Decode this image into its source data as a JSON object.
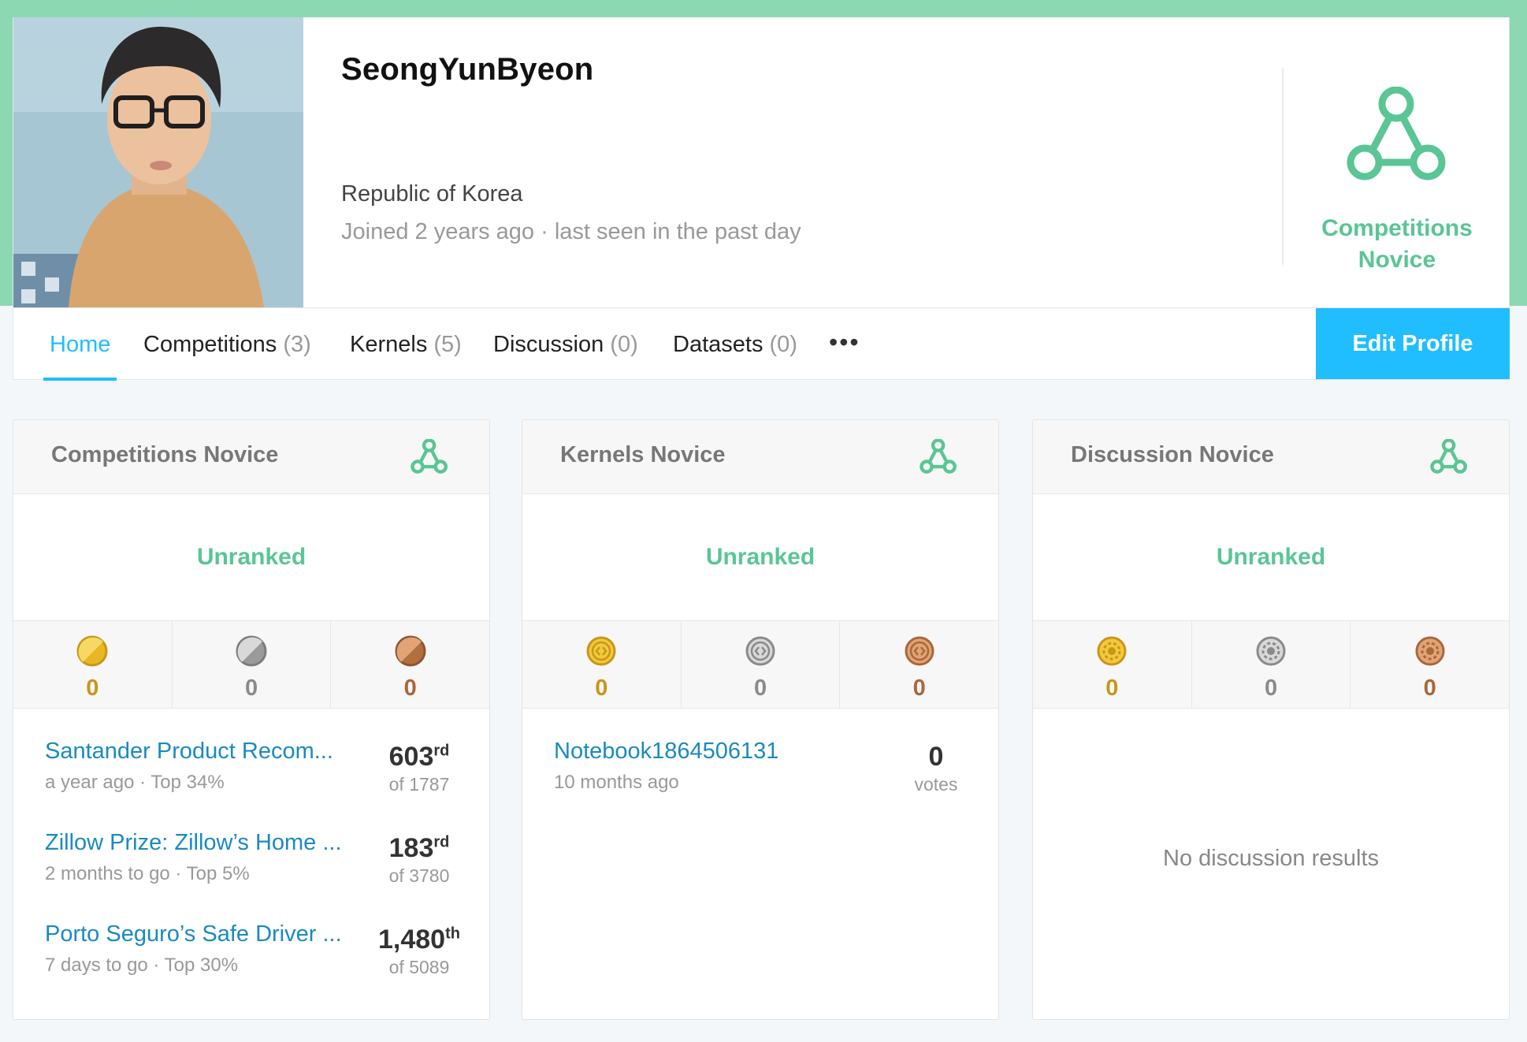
{
  "profile": {
    "username": "SeongYunByeon",
    "location": "Republic of Korea",
    "joined": "Joined 2 years ago · last seen in the past day",
    "tier": "Competitions\nNovice"
  },
  "colors": {
    "accent": "#20beff",
    "novice_green": "#5ac595",
    "link": "#1a8ac0",
    "header_band": "#8cd8b3"
  },
  "nav": {
    "tabs": [
      {
        "label": "Home",
        "count": ""
      },
      {
        "label": "Competitions",
        "count": "(3)"
      },
      {
        "label": "Kernels",
        "count": "(5)"
      },
      {
        "label": "Discussion",
        "count": "(0)"
      },
      {
        "label": "Datasets",
        "count": "(0)"
      }
    ],
    "more_label": "•••",
    "edit_label": "Edit Profile"
  },
  "panels": [
    {
      "title": "Competitions Novice",
      "rank": "Unranked",
      "medal_icon": "competition-medal-icon",
      "medals": {
        "gold": "0",
        "silver": "0",
        "bronze": "0"
      },
      "entries": [
        {
          "title": "Santander Product Recom...",
          "meta": "a year ago · Top 34%",
          "rank": "603",
          "suffix": "rd",
          "of": "of 1787"
        },
        {
          "title": "Zillow Prize: Zillow’s Home ...",
          "meta": "2 months to go · Top 5%",
          "rank": "183",
          "suffix": "rd",
          "of": "of 3780"
        },
        {
          "title": "Porto Seguro’s Safe Driver ...",
          "meta": "7 days to go · Top 30%",
          "rank": "1,480",
          "suffix": "th",
          "of": "of 5089"
        }
      ]
    },
    {
      "title": "Kernels Novice",
      "rank": "Unranked",
      "medal_icon": "kernel-medal-icon",
      "medals": {
        "gold": "0",
        "silver": "0",
        "bronze": "0"
      },
      "entries": [
        {
          "title": "Notebook1864506131",
          "meta": "10 months ago",
          "votes": "0",
          "votes_label": "votes"
        }
      ]
    },
    {
      "title": "Discussion Novice",
      "rank": "Unranked",
      "medal_icon": "discussion-medal-icon",
      "medals": {
        "gold": "0",
        "silver": "0",
        "bronze": "0"
      },
      "empty": "No discussion results"
    }
  ]
}
